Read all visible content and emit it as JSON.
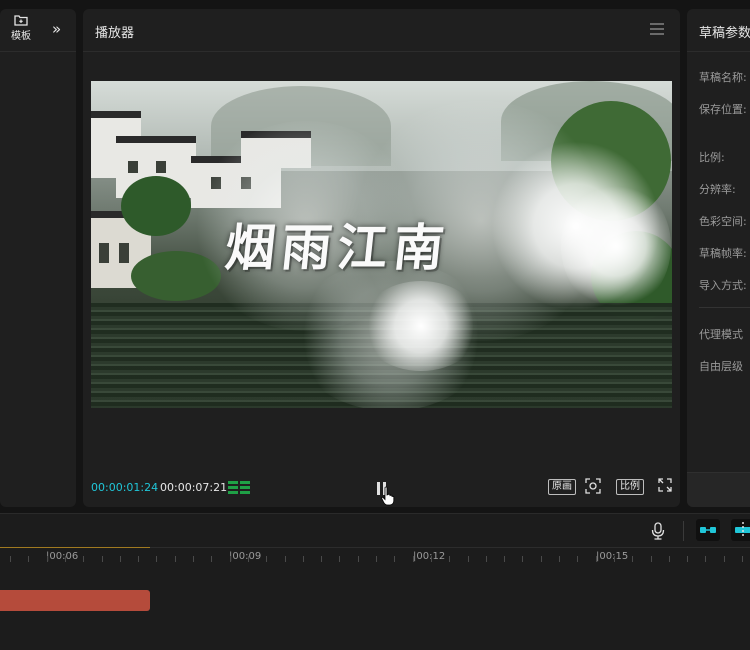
{
  "left_panel": {
    "template_label": "模板",
    "collapse_glyph": "»"
  },
  "player": {
    "title": "播放器",
    "video_title": "烟雨江南",
    "current_time": "00:00:01:24",
    "duration": "00:00:07:21",
    "original_label": "原画",
    "ratio_label": "比例"
  },
  "right_panel": {
    "title": "草稿参数",
    "params": [
      "草稿名称:",
      "保存位置:",
      "比例:",
      "分辨率:",
      "色彩空间:",
      "草稿帧率:",
      "导入方式:"
    ],
    "proxy_label": "代理模式（",
    "free_layer_label": "自由层级（"
  },
  "timeline": {
    "ticks": [
      "|00:06",
      "|00:09",
      "|00:12",
      "|00:15"
    ],
    "colors": {
      "accent": "#20c6d8",
      "clip": "#b54b3b",
      "meter": "#1fa046"
    }
  },
  "icons": [
    "template-icon",
    "collapse-icon",
    "menu-icon",
    "audio-meter-icon",
    "play-pause-icon",
    "fit-view-icon",
    "fullscreen-icon",
    "microphone-icon",
    "link-icon",
    "snap-icon"
  ]
}
